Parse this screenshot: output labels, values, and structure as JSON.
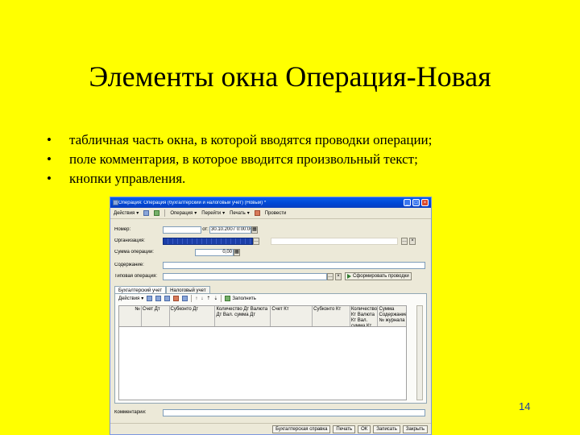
{
  "slide": {
    "title": "Элементы окна Операция-Новая",
    "bullets": [
      "табличная часть окна, в которой вводятся проводки операции;",
      "поле комментария, в которое вводится произвольный текст;",
      "кнопки управления."
    ],
    "bullet_glyph": "•",
    "page_number": "14"
  },
  "window": {
    "title": "Операция: Операция (бухгалтерский и налоговый учет) (Новый) *",
    "toolbar": {
      "actions": "Действия",
      "operation": "Операция",
      "go": "Перейти",
      "print": "Печать",
      "post": "Провести"
    },
    "form": {
      "number_label": "Номер:",
      "date_prefix": "от:",
      "date_value": "30.10.2007 0:00:00",
      "org_label": "Организация:",
      "amount_label": "Сумма операции:",
      "amount_value": "0,00",
      "content_label": "Содержание:",
      "typical_label": "Типовая операция:",
      "typical_button": "Сформировать проводки"
    },
    "tabs": [
      "Бухгалтерский учет",
      "Налоговый учет"
    ],
    "panel_toolbar": {
      "actions": "Действия",
      "fill": "Заполнить"
    },
    "columns": [
      "№",
      "Счет Дт",
      "Субконто Дт",
      "Количество Дт Валюта Дт Вал. сумма Дт",
      "Счет Кт",
      "Субконто Кт",
      "Количество Кт Валюта Кт Вал. сумма Кт",
      "Сумма Содержание № журнала"
    ],
    "comment_label": "Комментарий:",
    "bottom_buttons": [
      "Бухгалтерская справка",
      "Печать",
      "ОК",
      "Записать",
      "Закрыть"
    ]
  }
}
